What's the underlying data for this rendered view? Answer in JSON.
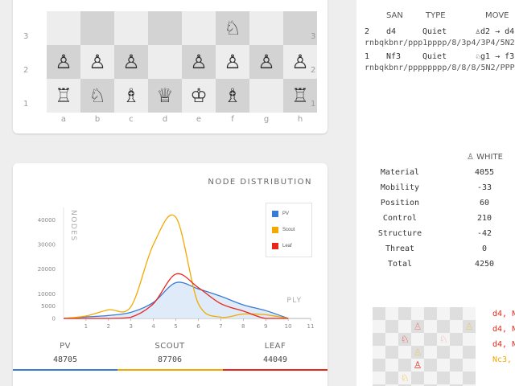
{
  "board": {
    "ranks": [
      {
        "label": "3",
        "squares": [
          "",
          "",
          "",
          "",
          "",
          "♘",
          "",
          ""
        ]
      },
      {
        "label": "2",
        "squares": [
          "♙",
          "♙",
          "♙",
          "",
          "♙",
          "♙",
          "♙",
          "♙"
        ]
      },
      {
        "label": "1",
        "squares": [
          "♖",
          "♘",
          "♗",
          "♕",
          "♔",
          "♗",
          "",
          "♖"
        ]
      }
    ],
    "files": [
      "a",
      "b",
      "c",
      "d",
      "e",
      "f",
      "g",
      "h"
    ],
    "partial_top_piece": "♗"
  },
  "chart": {
    "title": "NODE DISTRIBUTION",
    "xlabel": "PLY",
    "ylabel": "NODES"
  },
  "chart_data": {
    "type": "area",
    "title": "NODE DISTRIBUTION",
    "xlabel": "PLY",
    "ylabel": "NODES",
    "xlim": [
      0,
      11
    ],
    "ylim": [
      0,
      45000
    ],
    "xticks": [
      1,
      2,
      3,
      4,
      5,
      6,
      7,
      8,
      9,
      10,
      11
    ],
    "yticks": [
      0,
      5000,
      10000,
      20000,
      30000,
      40000
    ],
    "legend_position": "top-right",
    "x": [
      0,
      1,
      2,
      3,
      4,
      5,
      6,
      7,
      8,
      9,
      10
    ],
    "series": [
      {
        "name": "PV",
        "color": "#3a7bd5",
        "fill": "#dbe9f7",
        "values": [
          0,
          600,
          1200,
          2500,
          6500,
          14500,
          12000,
          9000,
          5500,
          3200,
          0
        ]
      },
      {
        "name": "Scout",
        "color": "#f2a900",
        "values": [
          0,
          1000,
          3500,
          4800,
          30000,
          41000,
          6000,
          500,
          1800,
          1500,
          0
        ]
      },
      {
        "name": "Leaf",
        "color": "#e8261c",
        "values": [
          0,
          0,
          0,
          500,
          6000,
          18000,
          12500,
          6000,
          3000,
          0,
          0
        ]
      }
    ]
  },
  "stats": [
    {
      "label": "PV",
      "value": "48705",
      "color": "#3a7bd5"
    },
    {
      "label": "SCOUT",
      "value": "87706",
      "color": "#f2a900"
    },
    {
      "label": "LEAF",
      "value": "44049",
      "color": "#e8261c"
    }
  ],
  "moves": {
    "headers": {
      "num": "",
      "san": "SAN",
      "type": "TYPE",
      "move": "MOVE"
    },
    "rows": [
      {
        "num": "2",
        "san": "d4",
        "type": "Quiet",
        "move": "♙d2 → d4",
        "fen": "rnbqkbnr/ppp1pppp/8/3p4/3P4/5N2/PPP1PPPP/RNBQKB1R"
      },
      {
        "num": "1",
        "san": "Nf3",
        "type": "Quiet",
        "move": "♘g1 → f3",
        "fen": "rnbqkbnr/pppppppp/8/8/8/5N2/PPPPPPPP/RNBQKB1R"
      }
    ]
  },
  "evaluation": {
    "header": "♙ WHITE",
    "rows": [
      {
        "name": "Material",
        "value": "4055"
      },
      {
        "name": "Mobility",
        "value": "-33"
      },
      {
        "name": "Position",
        "value": "60"
      },
      {
        "name": "Control",
        "value": "210"
      },
      {
        "name": "Structure",
        "value": "-42"
      },
      {
        "name": "Threat",
        "value": "0"
      },
      {
        "name": "Total",
        "value": "4250"
      }
    ]
  },
  "mini_board": {
    "pieces": [
      {
        "row": 1,
        "col": 3,
        "glyph": "♙",
        "color": "#e8261c",
        "faded": true
      },
      {
        "row": 1,
        "col": 7,
        "glyph": "♙",
        "color": "#f2a900",
        "faded": true
      },
      {
        "row": 2,
        "col": 2,
        "glyph": "♘",
        "color": "#e8261c",
        "faded": false
      },
      {
        "row": 2,
        "col": 5,
        "glyph": "♘",
        "color": "#e8261c",
        "faded": true
      },
      {
        "row": 3,
        "col": 3,
        "glyph": "♙",
        "color": "#f2a900",
        "faded": true
      },
      {
        "row": 4,
        "col": 3,
        "glyph": "♙",
        "color": "#e8261c",
        "faded": false
      },
      {
        "row": 5,
        "col": 2,
        "glyph": "♘",
        "color": "#f2a900",
        "faded": false
      }
    ]
  },
  "lines": [
    {
      "text": "d4, Nc",
      "color": "#e8261c"
    },
    {
      "text": "d4, Nc",
      "color": "#e8261c"
    },
    {
      "text": "d4, Nc",
      "color": "#e8261c"
    },
    {
      "text": "Nc3, d",
      "color": "#f2a900"
    }
  ]
}
